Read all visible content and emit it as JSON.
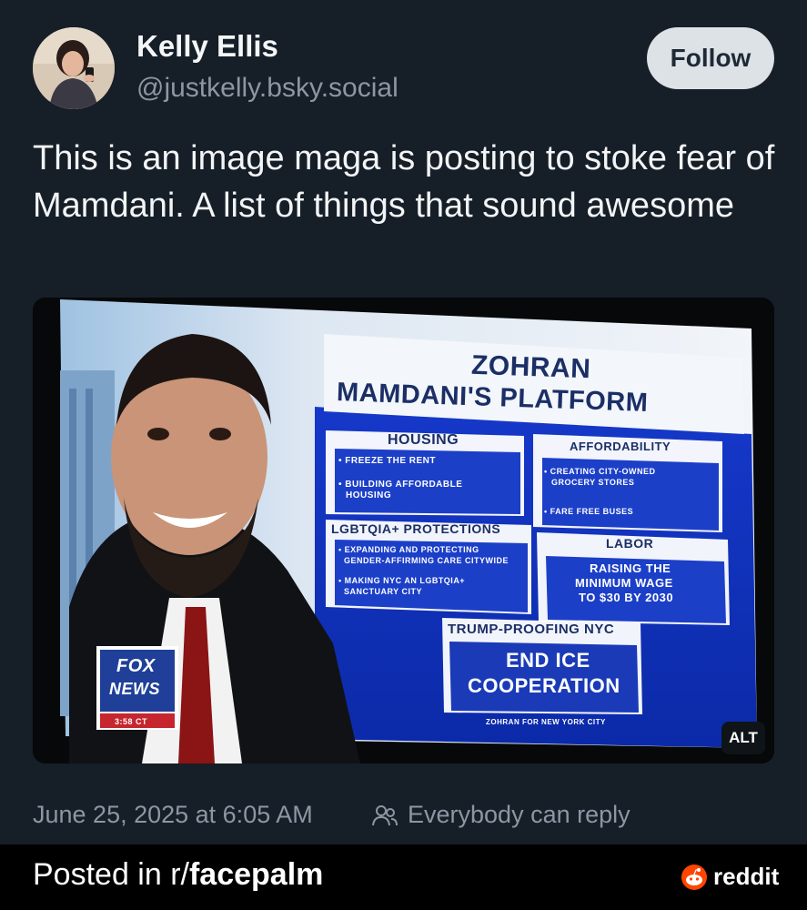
{
  "post": {
    "author_name": "Kelly Ellis",
    "author_handle": "@justkelly.bsky.social",
    "follow_label": "Follow",
    "text": "This is an image maga is posting to stoke fear of Mamdani. A list of things that sound awesome",
    "date": "June 25, 2025 at 6:05 AM",
    "reply_setting": "Everybody can reply",
    "reply_icon": "people-icon",
    "image": {
      "alt_badge": "ALT",
      "tv_graphic": {
        "title_line1": "ZOHRAN",
        "title_line2": "MAMDANI'S PLATFORM",
        "housing_header": "HOUSING",
        "housing_item1": "• FREEZE THE RENT",
        "housing_item2a": "• BUILDING AFFORDABLE",
        "housing_item2b": "HOUSING",
        "affordability_header": "AFFORDABILITY",
        "afford_item1a": "• CREATING CITY-OWNED",
        "afford_item1b": "GROCERY STORES",
        "afford_item2": "• FARE FREE BUSES",
        "lgbt_header": "LGBTQIA+ PROTECTIONS",
        "lgbt_item1a": "• EXPANDING AND PROTECTING",
        "lgbt_item1b": "GENDER-AFFIRMING CARE CITYWIDE",
        "lgbt_item2a": "• MAKING NYC AN LGBTQIA+",
        "lgbt_item2b": "SANCTUARY CITY",
        "labor_header": "LABOR",
        "labor_item1": "RAISING THE",
        "labor_item2": "MINIMUM WAGE",
        "labor_item3": "TO $30 BY 2030",
        "trump_header": "TRUMP-PROOFING NYC",
        "trump_item1": "END ICE",
        "trump_item2": "COOPERATION",
        "footer": "ZOHRAN FOR NEW YORK CITY",
        "network_line1": "FOX",
        "network_line2": "NEWS",
        "clock": "3:58 CT"
      }
    }
  },
  "banner": {
    "prefix": "Posted in r/",
    "subreddit": "facepalm",
    "brand": "reddit"
  },
  "colors": {
    "background": "#161e27",
    "follow_bg": "#dde2e7",
    "muted_text": "#8c97a4",
    "reddit_orange": "#ff4500"
  }
}
